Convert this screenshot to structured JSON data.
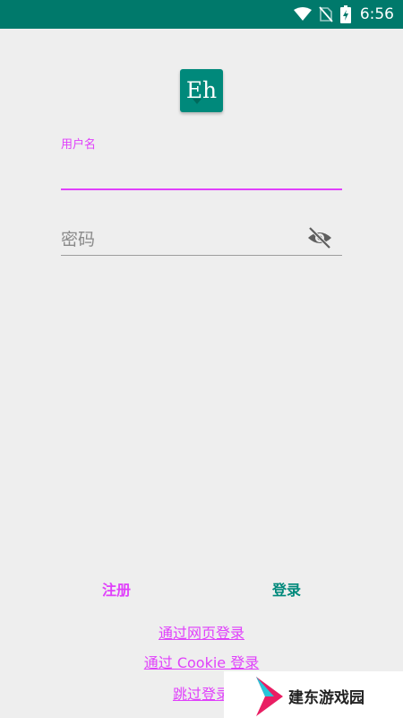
{
  "status_bar": {
    "time": "6:56",
    "icons": [
      "wifi-icon",
      "no-sim-icon",
      "battery-charging-icon"
    ],
    "color": "#00796b"
  },
  "logo": {
    "text": "Eh",
    "color": "#00897b"
  },
  "username": {
    "label": "用户名"
  },
  "password": {
    "placeholder": "密码",
    "icon": "visibility-off-icon"
  },
  "actions": {
    "register": "注册",
    "login": "登录",
    "web_login": "通过网页登录",
    "cookie_login": "通过 Cookie 登录",
    "skip_login": "跳过登录"
  },
  "colors": {
    "accent": "#e040fb",
    "primary": "#00897b"
  },
  "watermark": {
    "text": "建东游戏园"
  }
}
